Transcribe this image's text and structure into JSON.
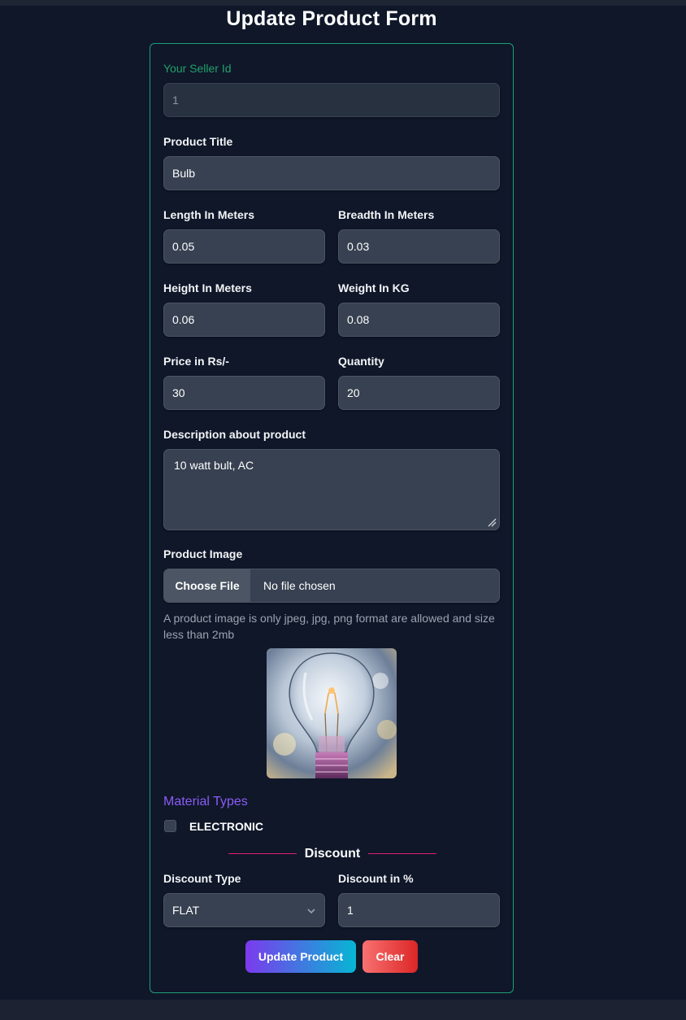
{
  "page": {
    "title": "Update Product Form"
  },
  "form": {
    "seller_id": {
      "label": "Your Seller Id",
      "value": "1"
    },
    "title": {
      "label": "Product Title",
      "value": "Bulb"
    },
    "length": {
      "label": "Length In Meters",
      "value": "0.05"
    },
    "breadth": {
      "label": "Breadth In Meters",
      "value": "0.03"
    },
    "height": {
      "label": "Height In Meters",
      "value": "0.06"
    },
    "weight": {
      "label": "Weight In KG",
      "value": "0.08"
    },
    "price": {
      "label": "Price in Rs/-",
      "value": "30"
    },
    "quantity": {
      "label": "Quantity",
      "value": "20"
    },
    "description": {
      "label": "Description about product",
      "value": "10 watt bult, AC"
    },
    "image": {
      "label": "Product Image",
      "button_label": "Choose File",
      "status": "No file chosen",
      "hint": "A product image is only jpeg, jpg, png format are allowed and size less than 2mb"
    },
    "material": {
      "title": "Material Types",
      "options": [
        {
          "label": "ELECTRONIC",
          "checked": false
        }
      ]
    },
    "discount": {
      "heading": "Discount",
      "type_label": "Discount Type",
      "type_value": "FLAT",
      "percent_label": "Discount in %",
      "percent_value": "1"
    },
    "actions": {
      "update_label": "Update Product",
      "clear_label": "Clear"
    }
  },
  "colors": {
    "background": "#0f1729",
    "card_border": "#1f9f77",
    "seller_label": "#22a06b",
    "material_title": "#8b5cf6",
    "divider": "#e11d6b",
    "update_gradient": [
      "#7c3aed",
      "#06b6d4"
    ],
    "clear_gradient": [
      "#f87171",
      "#dc2626"
    ]
  }
}
